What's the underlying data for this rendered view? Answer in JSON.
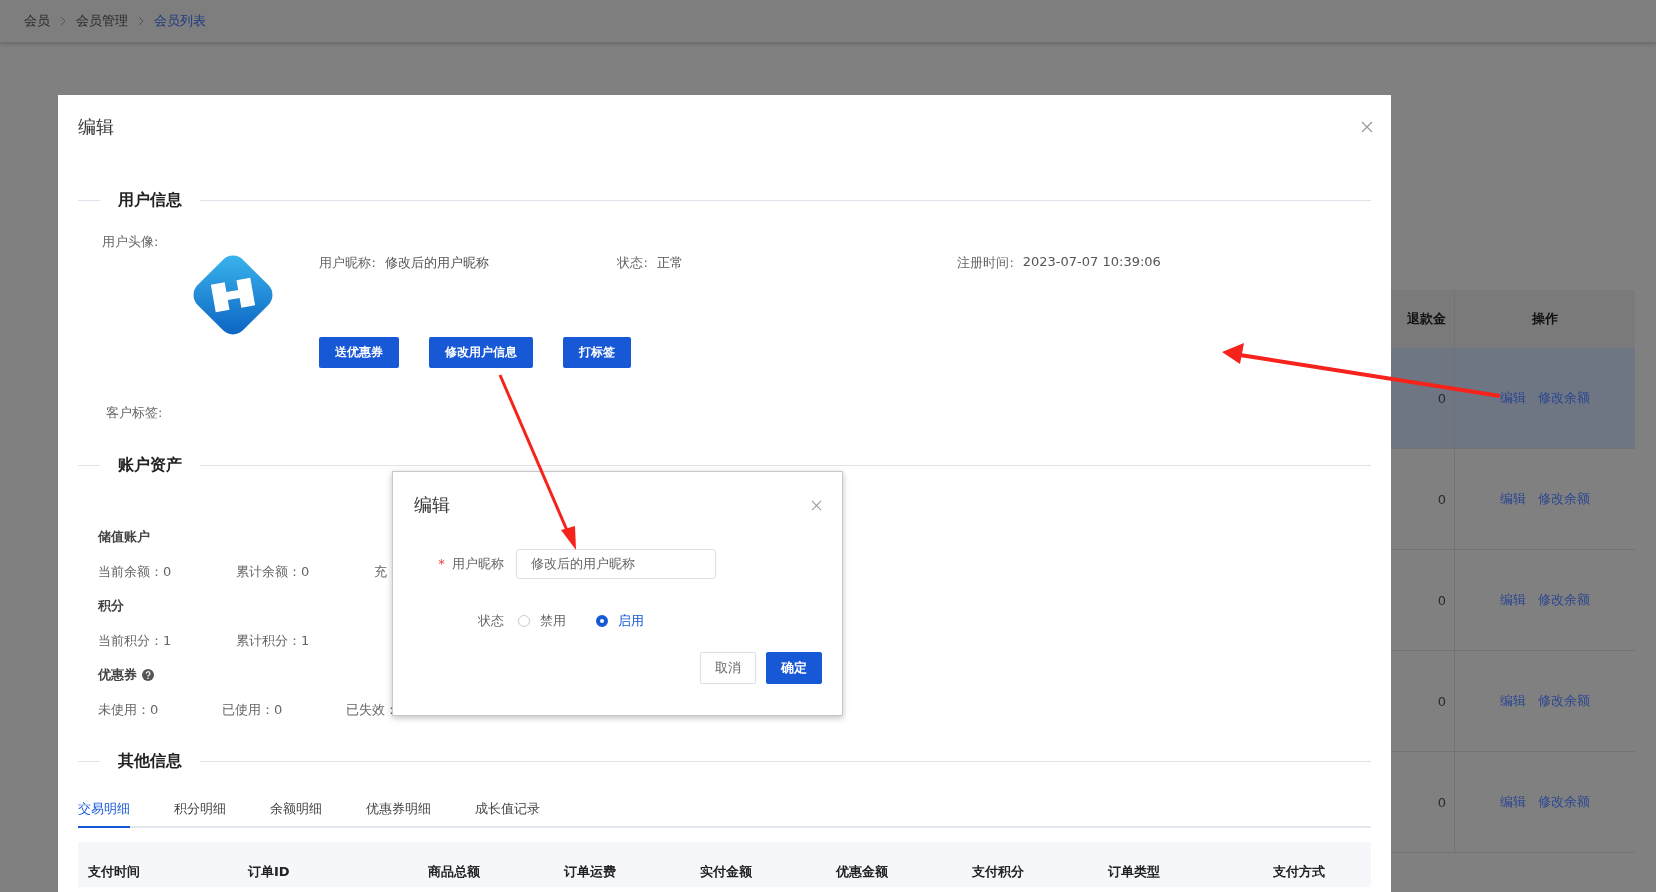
{
  "breadcrumb": [
    {
      "label": "会员",
      "current": false
    },
    {
      "label": "会员管理",
      "current": false
    },
    {
      "label": "会员列表",
      "current": true
    }
  ],
  "background_table": {
    "columns": [
      "退款金",
      "操作"
    ],
    "rows": [
      {
        "refund": "0",
        "actions": [
          "编辑",
          "修改余额"
        ],
        "selected": true
      },
      {
        "refund": "0",
        "actions": [
          "编辑",
          "修改余额"
        ],
        "selected": false
      },
      {
        "refund": "0",
        "actions": [
          "编辑",
          "修改余额"
        ],
        "selected": false
      },
      {
        "refund": "0",
        "actions": [
          "编辑",
          "修改余额"
        ],
        "selected": false
      },
      {
        "refund": "0",
        "actions": [
          "编辑",
          "修改余额"
        ],
        "selected": false
      }
    ]
  },
  "dialog": {
    "title": "编辑",
    "user_info": {
      "heading": "用户信息",
      "avatar_label": "用户头像:",
      "fields": [
        {
          "label": "用户昵称:",
          "value": "修改后的用户昵称"
        },
        {
          "label": "状态:",
          "value": "正常"
        },
        {
          "label": "注册时间:",
          "value": "2023-07-07 10:39:06"
        }
      ],
      "buttons": [
        "送优惠券",
        "修改用户信息",
        "打标签"
      ],
      "tags_label": "客户标签:"
    },
    "account_assets": {
      "heading": "账户资产",
      "groups": [
        {
          "title": "储值账户",
          "help": false,
          "items": [
            "当前余额：0",
            "累计余额：0",
            "充"
          ]
        },
        {
          "title": "积分",
          "help": false,
          "items": [
            "当前积分：1",
            "累计积分：1"
          ]
        },
        {
          "title": "优惠券",
          "help": true,
          "items": [
            "未使用：0",
            "已使用：0",
            "已失效："
          ]
        }
      ]
    },
    "other_info": {
      "heading": "其他信息",
      "tabs": [
        {
          "label": "交易明细",
          "selected": true
        },
        {
          "label": "积分明细",
          "selected": false
        },
        {
          "label": "余额明细",
          "selected": false
        },
        {
          "label": "优惠券明细",
          "selected": false
        },
        {
          "label": "成长值记录",
          "selected": false
        }
      ],
      "table": {
        "columns": [
          "支付时间",
          "订单ID",
          "商品总额",
          "订单运费",
          "实付金额",
          "优惠金额",
          "支付积分",
          "订单类型",
          "支付方式"
        ]
      }
    }
  },
  "edit_dialog": {
    "title": "编辑",
    "nickname": {
      "required_mark": "*",
      "label": "用户昵称",
      "value": "修改后的用户昵称"
    },
    "status": {
      "label": "状态",
      "options": [
        {
          "label": "禁用",
          "selected": false
        },
        {
          "label": "启用",
          "selected": true
        }
      ]
    },
    "buttons": [
      {
        "label": "取消",
        "kind": "default"
      },
      {
        "label": "确定",
        "kind": "primary"
      }
    ]
  }
}
